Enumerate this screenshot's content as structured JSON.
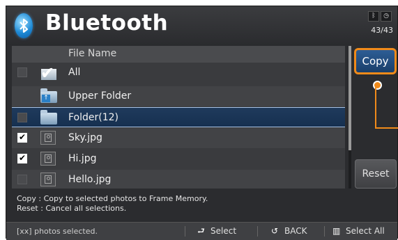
{
  "header": {
    "title": "Bluetooth",
    "counter": "43/43",
    "status_icons": [
      "bluetooth-icon",
      "clock-icon"
    ]
  },
  "list": {
    "column_header": "File Name",
    "rows": [
      {
        "label": "All",
        "icon": "check-all-icon",
        "checked": false
      },
      {
        "label": "Upper Folder",
        "icon": "upper-folder-icon",
        "checked": null
      },
      {
        "label": "Folder(12)",
        "icon": "folder-icon",
        "checked": false,
        "selected": true
      },
      {
        "label": "Sky.jpg",
        "icon": "photo-icon",
        "checked": true
      },
      {
        "label": "Hi.jpg",
        "icon": "photo-icon",
        "checked": true
      },
      {
        "label": "Hello.jpg",
        "icon": "photo-icon",
        "checked": false
      }
    ]
  },
  "buttons": {
    "copy": "Copy",
    "reset": "Reset"
  },
  "info": {
    "line1": "Copy : Copy to selected photos to Frame Memory.",
    "line2": "Reset : Cancel all selections."
  },
  "footer": {
    "status": "[xx] photos selected.",
    "select": "Select",
    "back": "BACK",
    "select_all": "Select All"
  },
  "colors": {
    "accent": "#f08a1a",
    "selection": "#1f3a5c",
    "background": "#2b2c2f"
  }
}
